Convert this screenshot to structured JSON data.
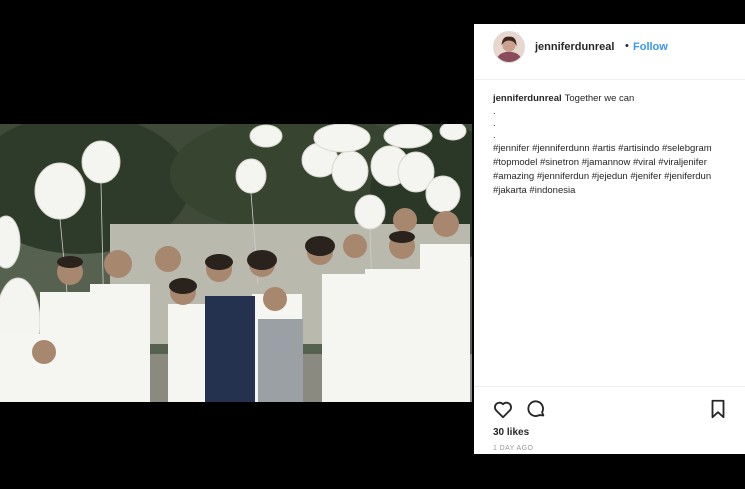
{
  "post": {
    "username": "jenniferdunreal",
    "separator": "•",
    "follow_label": "Follow",
    "caption_username": "jenniferdunreal",
    "caption_text": "Together we can",
    "caption_dots": [
      ".",
      ".",
      "."
    ],
    "hashtags": "#jennifer #jenniferdunn #artis #artisindo #selebgram #topmodel #sinetron #jamannow #viral #viraljenifer #amazing #jenniferdun #jejedun #jenifer #jeniferdun #jakarta #indonesia",
    "likes": "30 likes",
    "time_ago": "1 DAY AGO"
  },
  "icons": {
    "like": "heart-icon",
    "comment": "comment-icon",
    "save": "bookmark-icon"
  },
  "colors": {
    "background": "#000000",
    "follow_blue": "#3897f0",
    "text": "#262626",
    "muted": "#999999"
  }
}
